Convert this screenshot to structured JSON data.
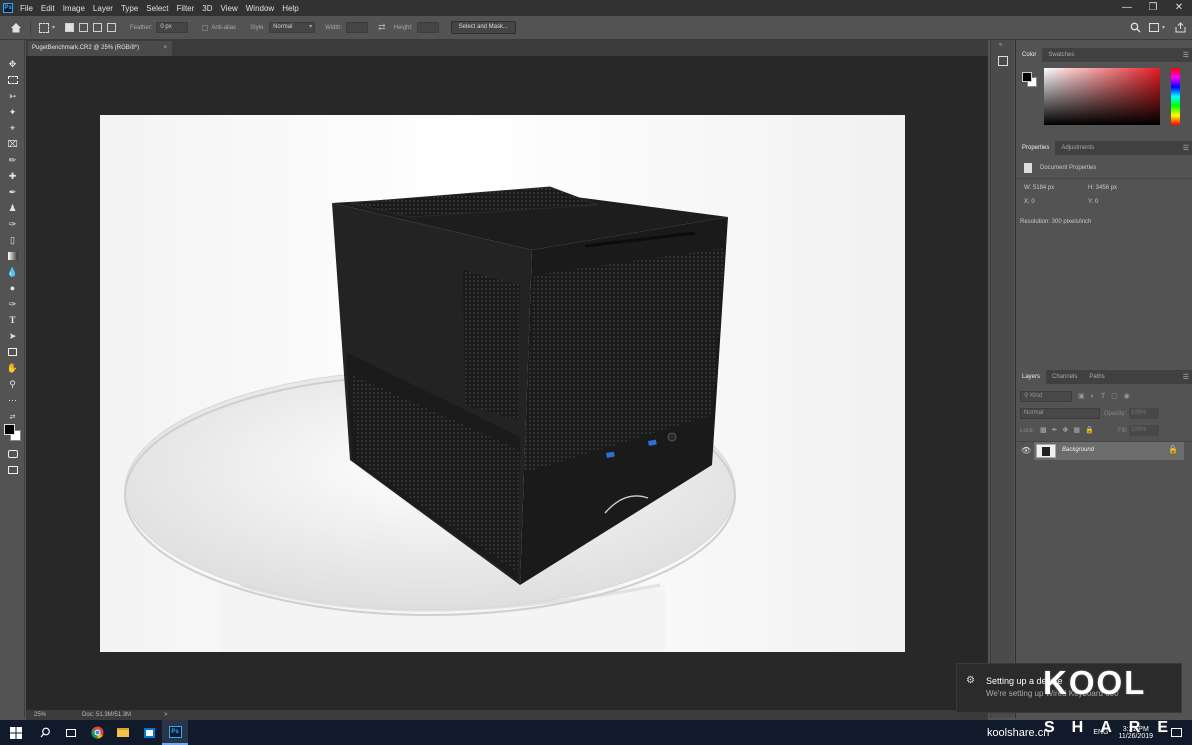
{
  "app": {
    "logo": "Ps"
  },
  "menubar": {
    "items": [
      "File",
      "Edit",
      "Image",
      "Layer",
      "Type",
      "Select",
      "Filter",
      "3D",
      "View",
      "Window",
      "Help"
    ]
  },
  "window_controls": {
    "minimize": "—",
    "restore": "❐",
    "close": "✕"
  },
  "options_bar": {
    "feather_label": "Feather:",
    "feather_value": "0 px",
    "antialias_label": "Anti-alias",
    "style_label": "Style:",
    "style_value": "Normal",
    "width_label": "Width:",
    "height_label": "Height:",
    "select_mask_button": "Select and Mask..."
  },
  "document": {
    "tab_title": "PugetBenchmark.CR2 @ 25% (RGB/8*)",
    "close": "×",
    "zoom": "25%",
    "doc_size": "Doc: 51.3M/51.3M",
    "status_arrow": ">"
  },
  "color_panel": {
    "tabs": [
      "Color",
      "Swatches"
    ]
  },
  "properties_panel": {
    "tabs": [
      "Properties",
      "Adjustments"
    ],
    "section": "Document Properties",
    "w": "W:  5184 px",
    "h": "H:  3456 px",
    "x": "X:  0",
    "y": "Y:  0",
    "resolution": "Resolution: 300 pixels/inch"
  },
  "layers_panel": {
    "tabs": [
      "Layers",
      "Channels",
      "Paths"
    ],
    "kind": "Kind",
    "blend_mode": "Normal",
    "opacity_label": "Opacity:",
    "opacity_value": "100%",
    "lock_label": "Lock:",
    "fill_label": "Fill:",
    "fill_value": "100%",
    "layers": [
      {
        "name": "Background",
        "visible": true,
        "locked": true
      }
    ]
  },
  "notification": {
    "title": "Setting up a device",
    "body": "We're setting up Wired Keyboard 600"
  },
  "watermark": {
    "text": "koolshare.cn",
    "logo_top": "KOOL",
    "logo_bottom": "SHARE"
  },
  "taskbar": {
    "language": "ENG",
    "time": "3:21 PM",
    "date": "11/26/2019",
    "ps_label": "Ps"
  },
  "colors": {
    "accent": "#31a8ff",
    "panel": "#535353",
    "canvas_bg": "#282828",
    "taskbar": "#111a2b"
  }
}
